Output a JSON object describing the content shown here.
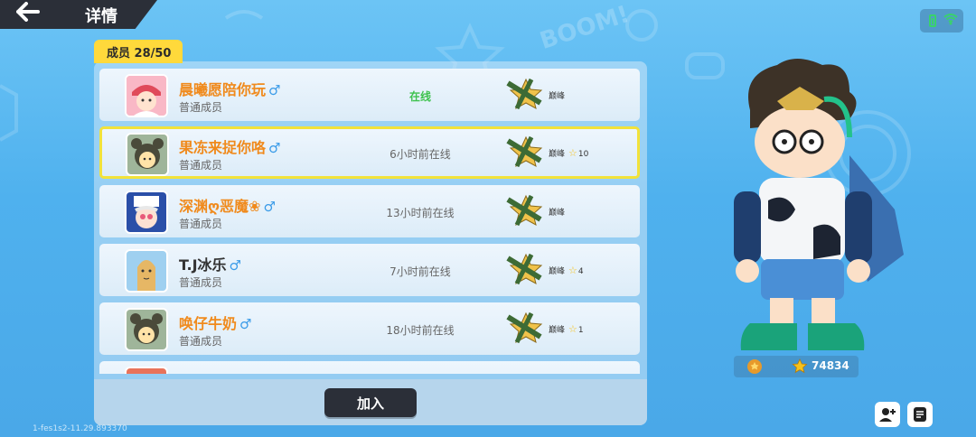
{
  "header": {
    "title": "详情",
    "back_icon": "back-arrow-icon"
  },
  "status": {
    "battery_color": "#39d36a",
    "wifi_color": "#39d36a"
  },
  "members": {
    "tab_label": "成员 28/50",
    "rows": [
      {
        "name": "晨曦愿陪你玩",
        "gender": "♂",
        "role": "普通成员",
        "online": "在线",
        "live": true,
        "rank": "巅峰",
        "stars": ""
      },
      {
        "name": "果冻来捉你咯",
        "gender": "♂",
        "role": "普通成员",
        "online": "6小时前在线",
        "live": false,
        "rank": "巅峰",
        "stars": "10"
      },
      {
        "name": "深渊ღ恶魔❀",
        "gender": "♂",
        "role": "普通成员",
        "online": "13小时前在线",
        "live": false,
        "rank": "巅峰",
        "stars": ""
      },
      {
        "name": "T.J冰乐",
        "gender": "♂",
        "role": "普通成员",
        "online": "7小时前在线",
        "live": false,
        "rank": "巅峰",
        "stars": "4"
      },
      {
        "name": "唤仔牛奶",
        "gender": "♂",
        "role": "普通成员",
        "online": "18小时前在线",
        "live": false,
        "rank": "巅峰",
        "stars": "1"
      }
    ],
    "selected_index": 1
  },
  "footer": {
    "join_label": "加入"
  },
  "version": "1-fes1s2-11.29.893370",
  "character": {
    "score": "74834"
  },
  "colors": {
    "accent": "#ffd93b",
    "name_orange": "#f08a1c",
    "online_green": "#3ec24e",
    "button_dark": "#2b2f38"
  }
}
